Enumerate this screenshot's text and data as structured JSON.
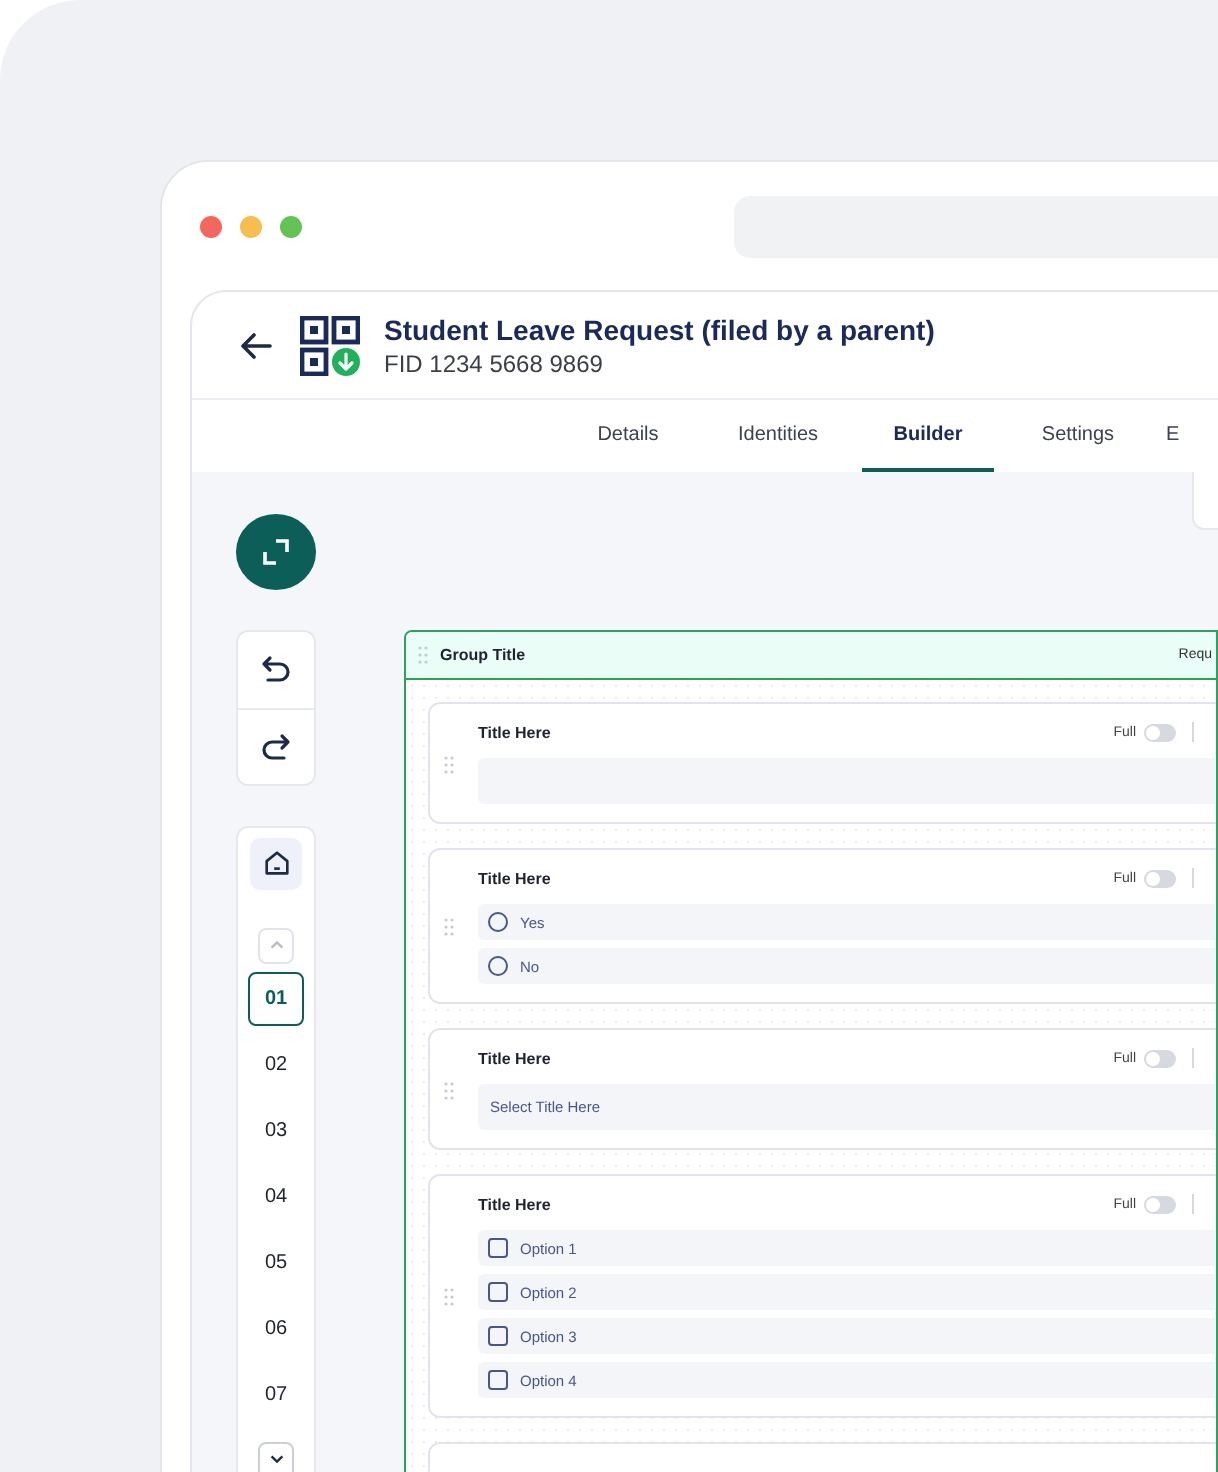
{
  "header": {
    "title": "Student Leave Request (filed by a parent)",
    "form_id": "FID 1234 5668 9869"
  },
  "tabs": [
    {
      "label": "Details",
      "selected": false
    },
    {
      "label": "Identities",
      "selected": false
    },
    {
      "label": "Builder",
      "selected": true
    },
    {
      "label": "Settings",
      "selected": false
    },
    {
      "label": "E",
      "selected": false
    }
  ],
  "page_nav": [
    {
      "label": "01",
      "selected": true
    },
    {
      "label": "02",
      "selected": false
    },
    {
      "label": "03",
      "selected": false
    },
    {
      "label": "04",
      "selected": false
    },
    {
      "label": "05",
      "selected": false
    },
    {
      "label": "06",
      "selected": false
    },
    {
      "label": "07",
      "selected": false
    }
  ],
  "group": {
    "title": "Group Title",
    "right_label": "Requ",
    "fields": [
      {
        "kind": "text",
        "title": "Title Here",
        "full_label": "Full",
        "full": false
      },
      {
        "kind": "radio",
        "title": "Title Here",
        "full_label": "Full",
        "full": false,
        "options": [
          {
            "label": "Yes",
            "selected": false
          },
          {
            "label": "No",
            "selected": false
          }
        ]
      },
      {
        "kind": "select",
        "title": "Title Here",
        "full_label": "Full",
        "full": false,
        "placeholder": "Select Title Here"
      },
      {
        "kind": "checkbox",
        "title": "Title Here",
        "full_label": "Full",
        "full": false,
        "options": [
          {
            "label": "Option 1",
            "checked": false
          },
          {
            "label": "Option 2",
            "checked": false
          },
          {
            "label": "Option 3",
            "checked": false
          },
          {
            "label": "Option 4",
            "checked": false
          }
        ]
      },
      {
        "kind": "blank"
      }
    ]
  }
}
